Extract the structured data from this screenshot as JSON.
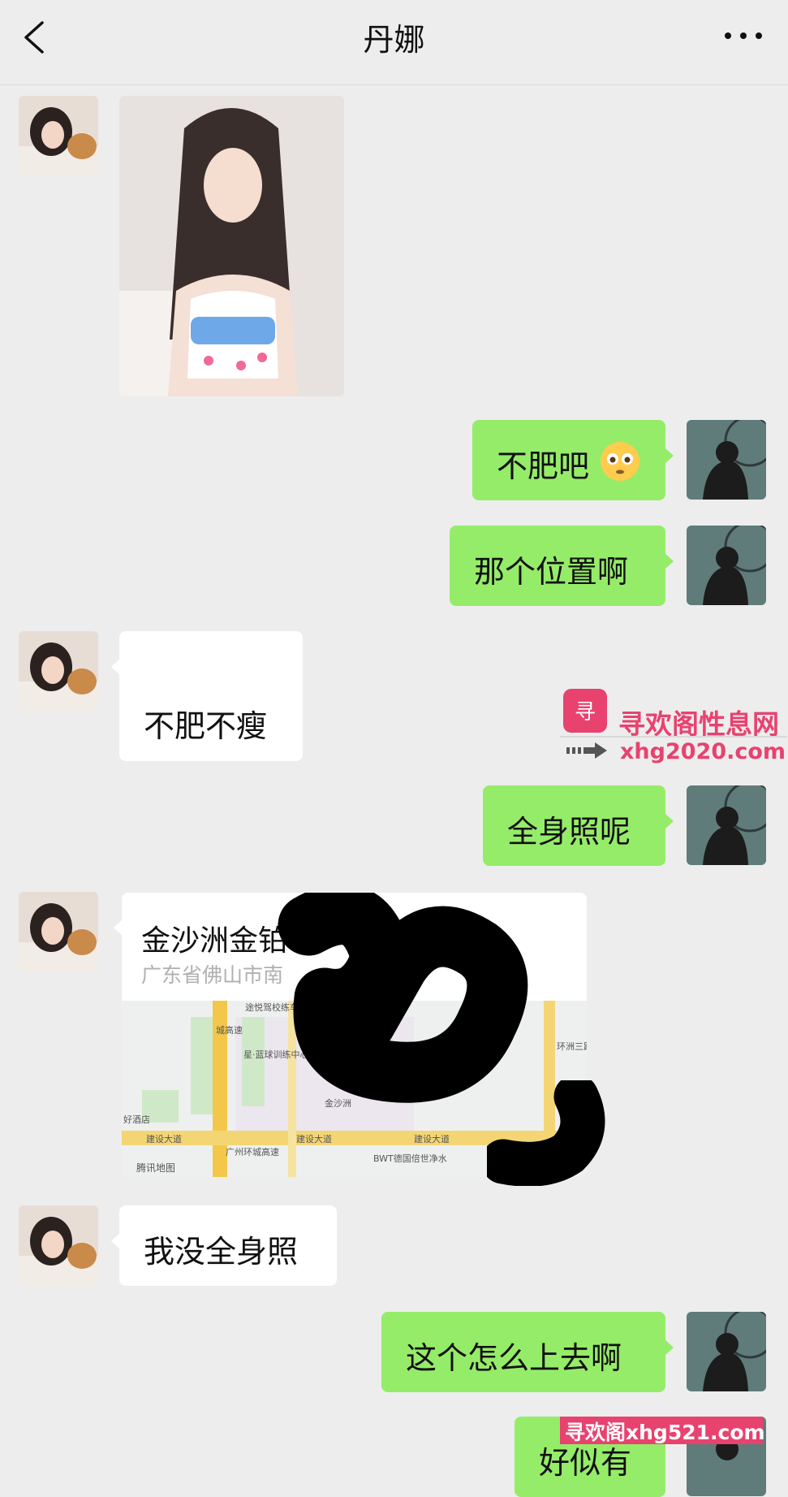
{
  "header": {
    "title": "丹娜"
  },
  "messages": [
    {
      "text": "不肥吧"
    },
    {
      "text": "那个位置啊"
    },
    {
      "text": "不肥不瘦"
    },
    {
      "text": "全身照呢"
    },
    {
      "text": "我没全身照"
    },
    {
      "text": "这个怎么上去啊"
    },
    {
      "text": "好似有"
    }
  ],
  "location": {
    "name": "金沙洲金铂",
    "address": "广东省佛山市南",
    "map_labels": [
      "途悦驾校练车场",
      "城高速",
      "环洲三路",
      "星·蓝球训练中心",
      "金沙洲",
      "建设大道",
      "建设大道",
      "建设大道",
      "广州环城高速",
      "BWT德国倍世净水",
      "好酒店",
      "腾讯地图"
    ]
  },
  "watermark": {
    "brand": "寻欢阁性息网",
    "url": "xhg2020.com",
    "bottom": "寻欢阁xhg521.com"
  },
  "colors": {
    "bubble_right": "#95ec69",
    "bubble_left": "#ffffff",
    "background": "#ededed",
    "watermark": "#e8426f"
  }
}
